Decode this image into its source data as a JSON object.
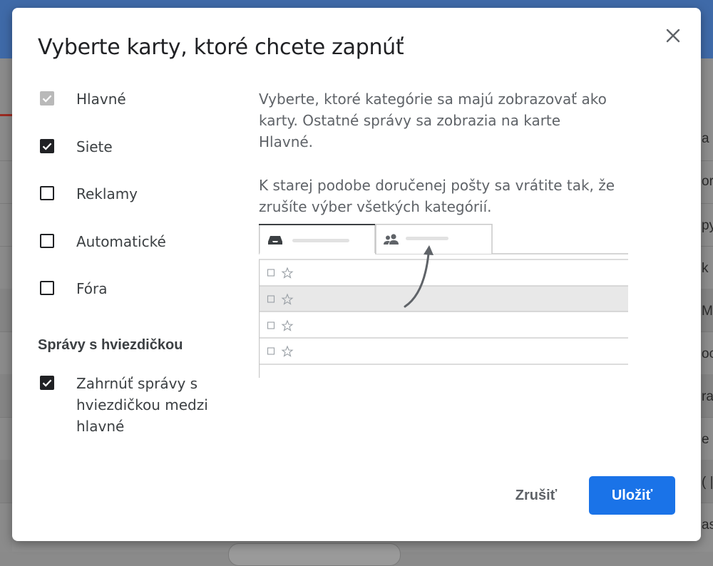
{
  "dialog": {
    "title": "Vyberte karty, ktoré chcete zapnúť",
    "close_icon": "close-icon"
  },
  "categories": [
    {
      "label": "Hlavné",
      "checked": true,
      "disabled": true
    },
    {
      "label": "Siete",
      "checked": true,
      "disabled": false
    },
    {
      "label": "Reklamy",
      "checked": false,
      "disabled": false
    },
    {
      "label": "Automatické",
      "checked": false,
      "disabled": false
    },
    {
      "label": "Fóra",
      "checked": false,
      "disabled": false
    }
  ],
  "starred": {
    "heading": "Správy s hviezdičkou",
    "option_label": "Zahrnúť správy s hviezdičkou medzi hlavné",
    "checked": true
  },
  "description": {
    "paragraph1": "Vyberte, ktoré kategórie sa majú zobrazovať ako karty. Ostatné správy sa zobrazia na karte Hlavné.",
    "paragraph2": "K starej podobe doručenej pošty sa vrátite tak, že zrušíte výber všetkých kategórií."
  },
  "illustration": {
    "tab1_icon": "inbox-icon",
    "tab2_icon": "people-icon",
    "row_icons": [
      "checkbox-icon",
      "star-icon"
    ]
  },
  "buttons": {
    "cancel_label": "Zrušiť",
    "save_label": "Uložiť"
  },
  "colors": {
    "accent": "#1a73e8",
    "checkbox_checked": "#202124",
    "checkbox_disabled": "#b9b9b9",
    "title_text": "#202124",
    "body_text": "#5f6368"
  },
  "background": {
    "snippets": [
      "a",
      "ork",
      "py",
      "k",
      "M",
      "oc",
      "ra",
      "e y",
      "( |",
      "ast"
    ]
  }
}
